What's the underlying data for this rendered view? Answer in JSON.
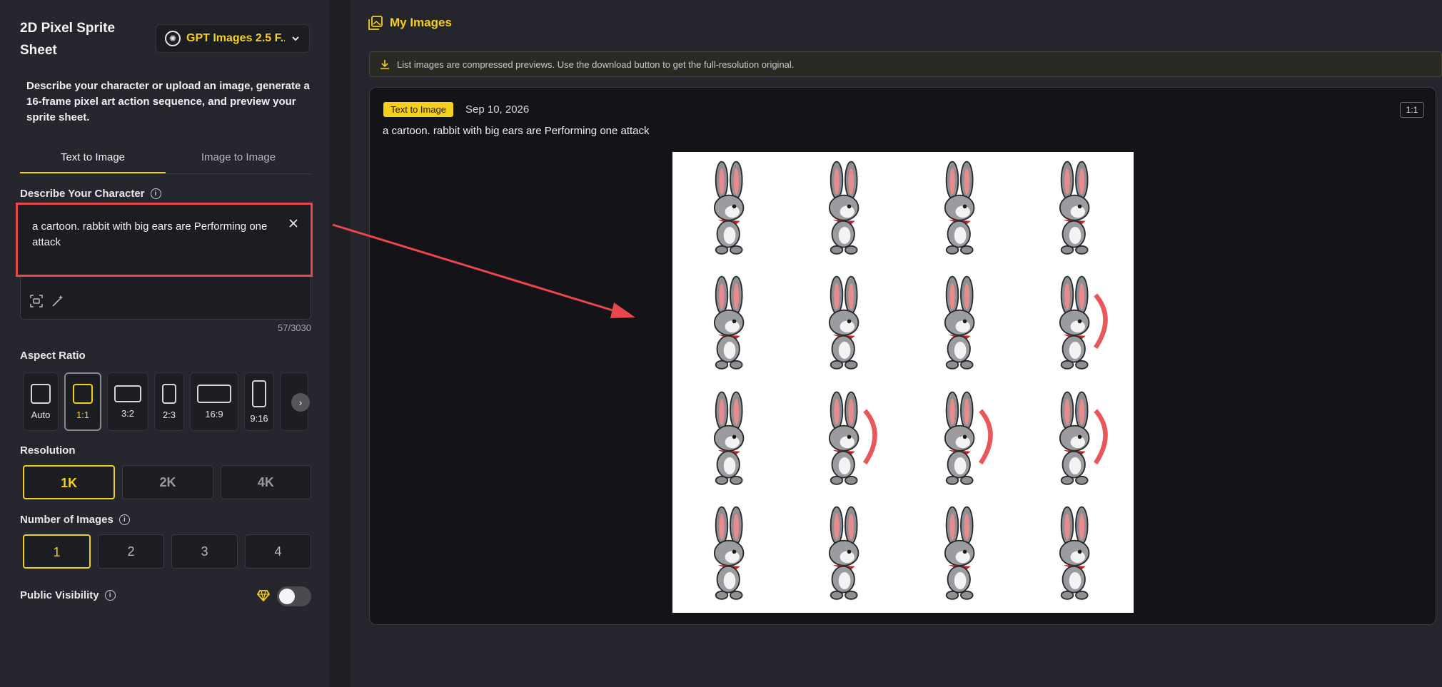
{
  "app": {
    "title": "2D Pixel Sprite Sheet",
    "model": "GPT Images 2.5 F..."
  },
  "description": "Describe your character or upload an image, generate a 16-frame pixel art action sequence, and preview your sprite sheet.",
  "tabs": [
    {
      "label": "Text to Image"
    },
    {
      "label": "Image to Image"
    }
  ],
  "character": {
    "label": "Describe Your Character",
    "value": "a cartoon. rabbit with big ears are Performing one attack",
    "counter": "57/3030"
  },
  "aspect": {
    "label": "Aspect Ratio",
    "options": [
      "Auto",
      "1:1",
      "3:2",
      "2:3",
      "16:9",
      "9:16"
    ],
    "selected": "1:1"
  },
  "resolution": {
    "label": "Resolution",
    "options": [
      "1K",
      "2K",
      "4K"
    ],
    "selected": "1K"
  },
  "count": {
    "label": "Number of Images",
    "options": [
      "1",
      "2",
      "3",
      "4"
    ],
    "selected": "1"
  },
  "visibility": {
    "label": "Public Visibility",
    "enabled": false
  },
  "right": {
    "title": "My Images",
    "notice": "List images are compressed previews. Use the download button to get the full-resolution original.",
    "card": {
      "badge": "Text to Image",
      "date": "Sep 10, 2026",
      "ratio": "1:1",
      "prompt": "a cartoon. rabbit with big ears are Performing one attack"
    }
  },
  "colors": {
    "accent": "#f5cf1d",
    "highlight": "#e9474c",
    "panel": "#26272e"
  }
}
